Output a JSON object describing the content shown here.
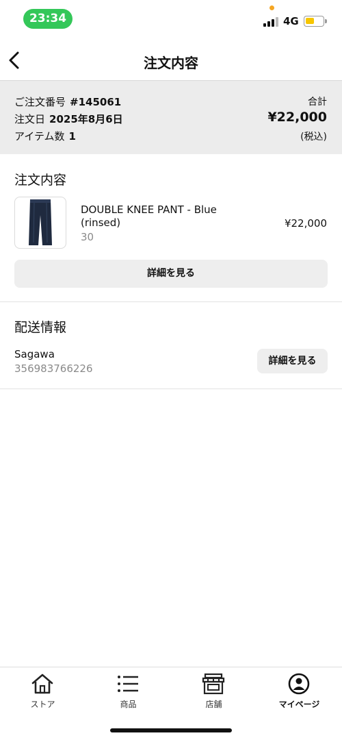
{
  "status_bar": {
    "time": "23:34",
    "network": "4G"
  },
  "header": {
    "title": "注文内容"
  },
  "summary": {
    "order_number_label": "ご注文番号",
    "order_number": "#145061",
    "order_date_label": "注文日",
    "order_date": "2025年8月6日",
    "item_count_label": "アイテム数",
    "item_count": "1",
    "total_label": "合計",
    "total_amount": "¥22,000",
    "tax_note": "(税込)"
  },
  "order_section": {
    "title": "注文内容",
    "item": {
      "name": "DOUBLE KNEE PANT  - Blue (rinsed)",
      "size": "30",
      "price": "¥22,000"
    },
    "details_button": "詳細を見る"
  },
  "shipping_section": {
    "title": "配送情報",
    "carrier": "Sagawa",
    "tracking_number": "356983766226",
    "details_button": "詳細を見る"
  },
  "tabbar": {
    "items": [
      {
        "label": "ストア",
        "icon": "home-icon"
      },
      {
        "label": "商品",
        "icon": "list-icon"
      },
      {
        "label": "店舗",
        "icon": "store-icon"
      },
      {
        "label": "マイページ",
        "icon": "user-circle-icon"
      }
    ],
    "active": "マイページ"
  },
  "colors": {
    "time_pill": "#34c759",
    "summary_bg": "#ececec",
    "button_bg": "#eeeeee",
    "battery": "#f7c600"
  }
}
